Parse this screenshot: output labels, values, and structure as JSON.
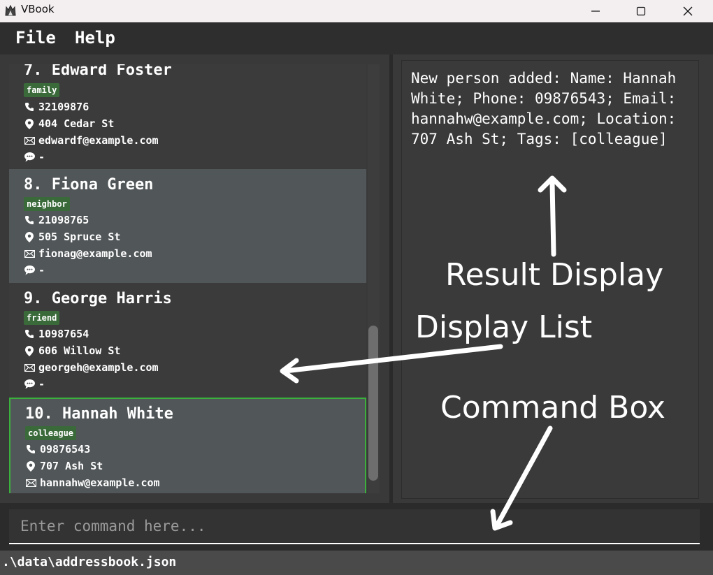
{
  "window": {
    "title": "VBook",
    "controls": [
      "minimize-icon",
      "maximize-icon",
      "close-icon"
    ]
  },
  "menu": {
    "file": "File",
    "help": "Help"
  },
  "persons": [
    {
      "index_name": "7. Edward Foster",
      "tag": "family",
      "phone": "32109876",
      "location": "404 Cedar St",
      "email": "edwardf@example.com",
      "remark": "-"
    },
    {
      "index_name": "8. Fiona Green",
      "tag": "neighbor",
      "phone": "21098765",
      "location": "505 Spruce St",
      "email": "fionag@example.com",
      "remark": "-"
    },
    {
      "index_name": "9. George Harris",
      "tag": "friend",
      "phone": "10987654",
      "location": "606 Willow St",
      "email": "georgeh@example.com",
      "remark": "-"
    },
    {
      "index_name": "10. Hannah White",
      "tag": "colleague",
      "phone": "09876543",
      "location": "707 Ash St",
      "email": "hannahw@example.com",
      "selected": true
    }
  ],
  "result": {
    "text": "New person added: Name: Hannah White; Phone: 09876543; Email: hannahw@example.com; Location: 707 Ash St; Tags: [colleague]"
  },
  "command": {
    "placeholder": "Enter command here..."
  },
  "status": {
    "file_path": ".\\data\\addressbook.json"
  },
  "annotations": {
    "result_display": "Result Display",
    "display_list": "Display List",
    "command_box": "Command Box"
  },
  "colors": {
    "tag_bg": "#3a6a3a",
    "selected_border": "#3cb03c",
    "panel_bg": "#393939"
  }
}
